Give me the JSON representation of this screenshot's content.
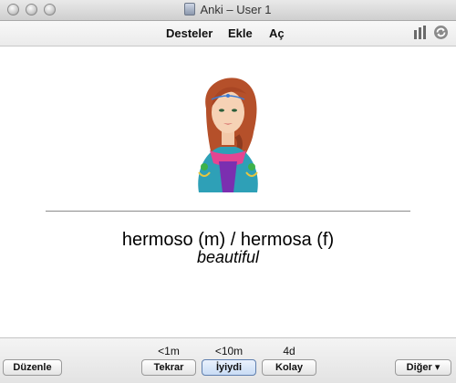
{
  "window": {
    "title": "Anki – User 1"
  },
  "toolbar": {
    "menu": [
      "Desteler",
      "Ekle",
      "Aç"
    ],
    "icons": [
      "stats-icon",
      "sync-icon"
    ]
  },
  "card": {
    "image": "woman-portrait-illustration",
    "front": "hermoso (m) / hermosa (f)",
    "back": "beautiful"
  },
  "bottom": {
    "edit_label": "Düzenle",
    "answers": [
      {
        "label": "Tekrar",
        "interval": "<1m"
      },
      {
        "label": "İyiydi",
        "interval": "<10m"
      },
      {
        "label": "Kolay",
        "interval": "4d"
      }
    ],
    "more_label": "Diğer ▾"
  },
  "colors": {
    "titlebar": "#dcdcdc",
    "toolbar": "#f2f2f2",
    "divider": "#8c8c8c"
  }
}
